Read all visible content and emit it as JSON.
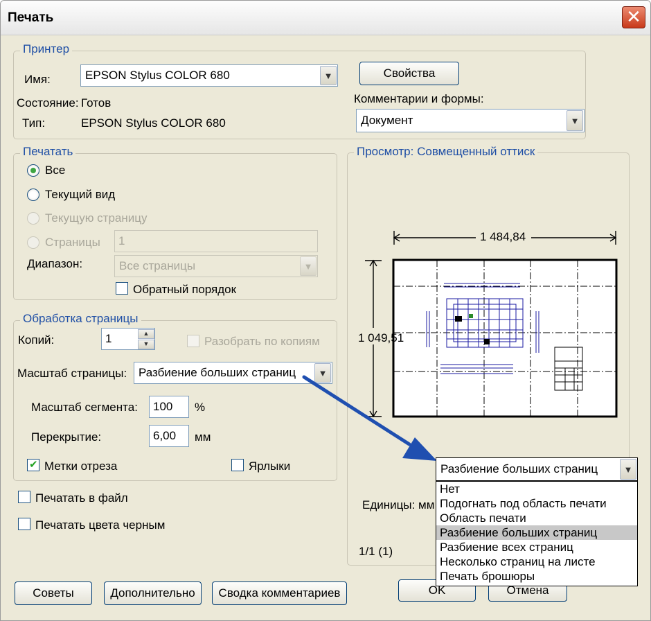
{
  "window": {
    "title": "Печать",
    "close_label": "✕"
  },
  "printer": {
    "legend": "Принтер",
    "name_label": "Имя:",
    "name_value": "EPSON Stylus COLOR 680",
    "properties_button": "Свойства",
    "status_label": "Состояние:",
    "status_value": "Готов",
    "type_label": "Тип:",
    "type_value": "EPSON Stylus COLOR 680",
    "comments_label": "Комментарии и формы:",
    "comments_value": "Документ"
  },
  "print_range": {
    "legend": "Печатать",
    "all_label": "Все",
    "current_view_label": "Текущий вид",
    "current_page_label": "Текущую страницу",
    "pages_label": "Страницы",
    "pages_value": "1",
    "subset_label": "Диапазон:",
    "subset_value": "Все страницы",
    "reverse_label": "Обратный порядок"
  },
  "page_handling": {
    "legend": "Обработка страницы",
    "copies_label": "Копий:",
    "copies_value": "1",
    "collate_label": "Разобрать по копиям",
    "scaling_label": "Масштаб страницы:",
    "scaling_value": "Разбиение больших страниц",
    "tile_scale_label": "Масштаб сегмента:",
    "tile_scale_value": "100",
    "tile_scale_unit": "%",
    "overlap_label": "Перекрытие:",
    "overlap_value": "6,00",
    "overlap_unit": "мм",
    "cut_marks_label": "Метки отреза",
    "labels_label": "Ярлыки"
  },
  "options": {
    "print_to_file_label": "Печатать в файл",
    "print_black_label": "Печатать цвета черным"
  },
  "preview": {
    "legend": "Просмотр: Совмещенный оттиск",
    "width_value": "1 484,84",
    "height_value": "1 049,51",
    "units_label": "Единицы: мм",
    "page_counter": "1/1 (1)"
  },
  "dropdown": {
    "selected": "Разбиение больших страниц",
    "options": [
      "Нет",
      "Подогнать под область печати",
      "Область печати",
      "Разбиение больших страниц",
      "Разбиение всех страниц",
      "Несколько страниц на листе",
      "Печать брошюры"
    ]
  },
  "buttons": {
    "tips": "Советы",
    "advanced": "Дополнительно",
    "summarize": "Сводка комментариев",
    "ok": "OK",
    "cancel": "Отмена"
  },
  "colors": {
    "legend_blue": "#1e4ea5",
    "arrow_blue": "#1f4fb0",
    "check_green": "#21a121"
  }
}
